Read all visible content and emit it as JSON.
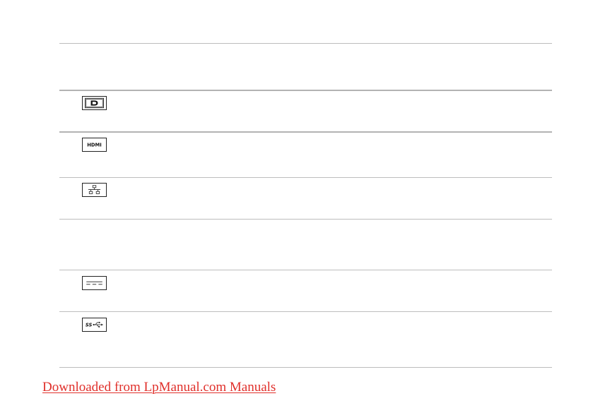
{
  "page": {
    "icons": [
      {
        "name": "displayport-icon"
      },
      {
        "name": "hdmi-icon",
        "text": "HDMI"
      },
      {
        "name": "network-icon"
      },
      {
        "name": "dc-power-icon"
      },
      {
        "name": "usb3-superspeed-icon",
        "text": "SS"
      }
    ],
    "colors": {
      "rule": "#bdbdbd",
      "icon_stroke": "#222222",
      "footer_link": "#e0302b"
    }
  },
  "footer": {
    "link_text": "Downloaded from LpManual.com Manuals"
  }
}
